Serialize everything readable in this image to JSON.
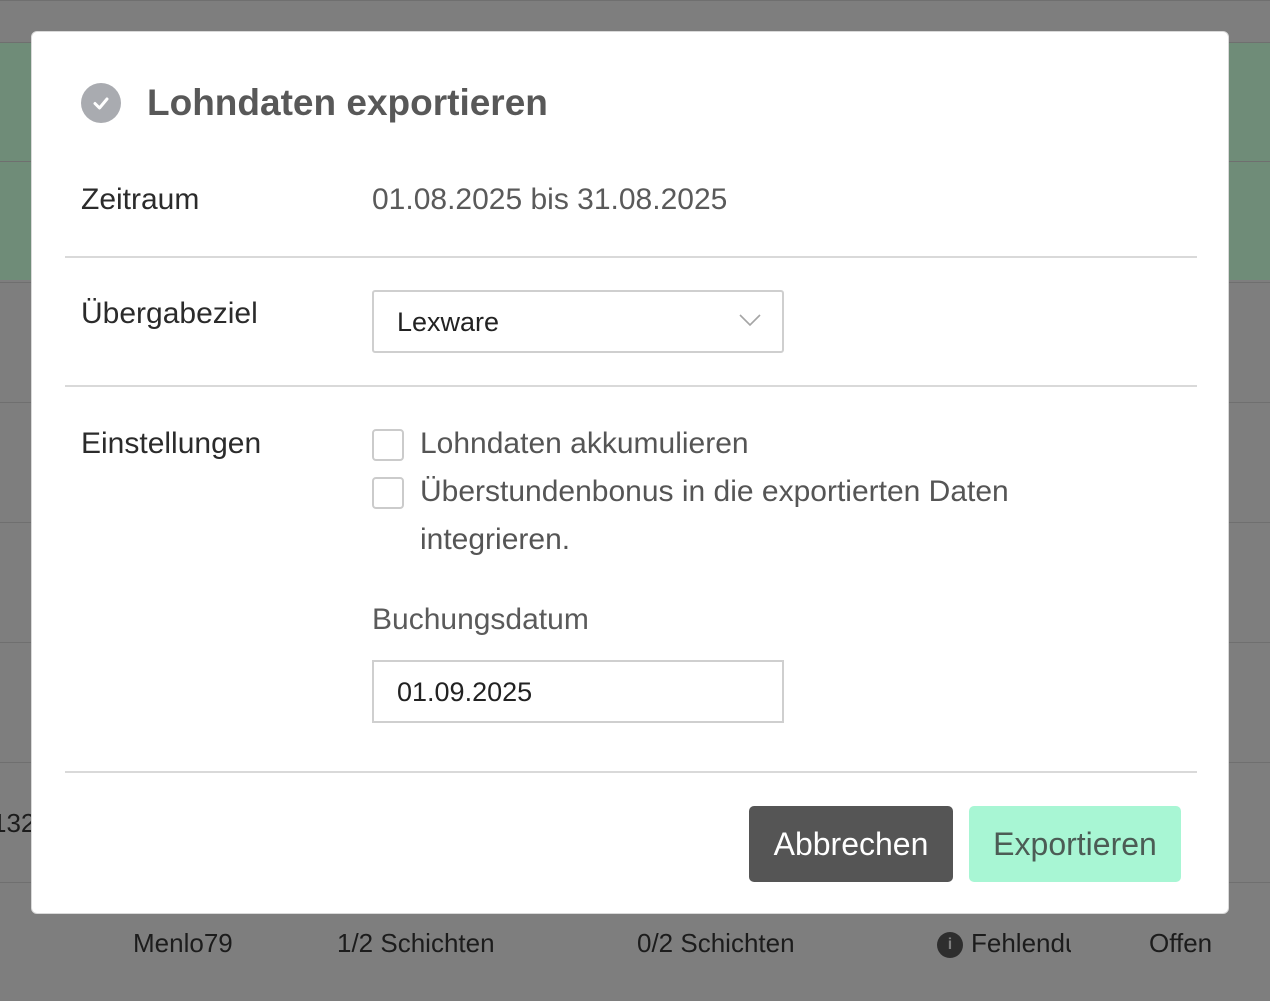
{
  "background": {
    "partial_text": "132",
    "row": {
      "name": "Menlo79",
      "col1": "1/2 Schichten",
      "col2": "0/2 Schichten",
      "col3": "Fehlendu",
      "col4": "Offen"
    }
  },
  "dialog": {
    "title": "Lohndaten exportieren",
    "title_icon": "check-circle-icon",
    "period": {
      "label": "Zeitraum",
      "value": "01.08.2025 bis 31.08.2025"
    },
    "target": {
      "label": "Übergabeziel",
      "selected": "Lexware"
    },
    "settings": {
      "label": "Einstellungen",
      "options": [
        {
          "label": "Lohndaten akkumulieren",
          "checked": false
        },
        {
          "label": "Überstundenbonus in die exportierten Daten integrieren.",
          "checked": false
        }
      ],
      "booking_date_label": "Buchungsdatum",
      "booking_date_value": "01.09.2025"
    },
    "buttons": {
      "cancel": "Abbrechen",
      "export": "Exportieren"
    }
  },
  "colors": {
    "overlay": "#7e7e7e",
    "export_button": "#a8f6d4",
    "cancel_button": "#555555",
    "highlight_row": "#6f8c78"
  }
}
